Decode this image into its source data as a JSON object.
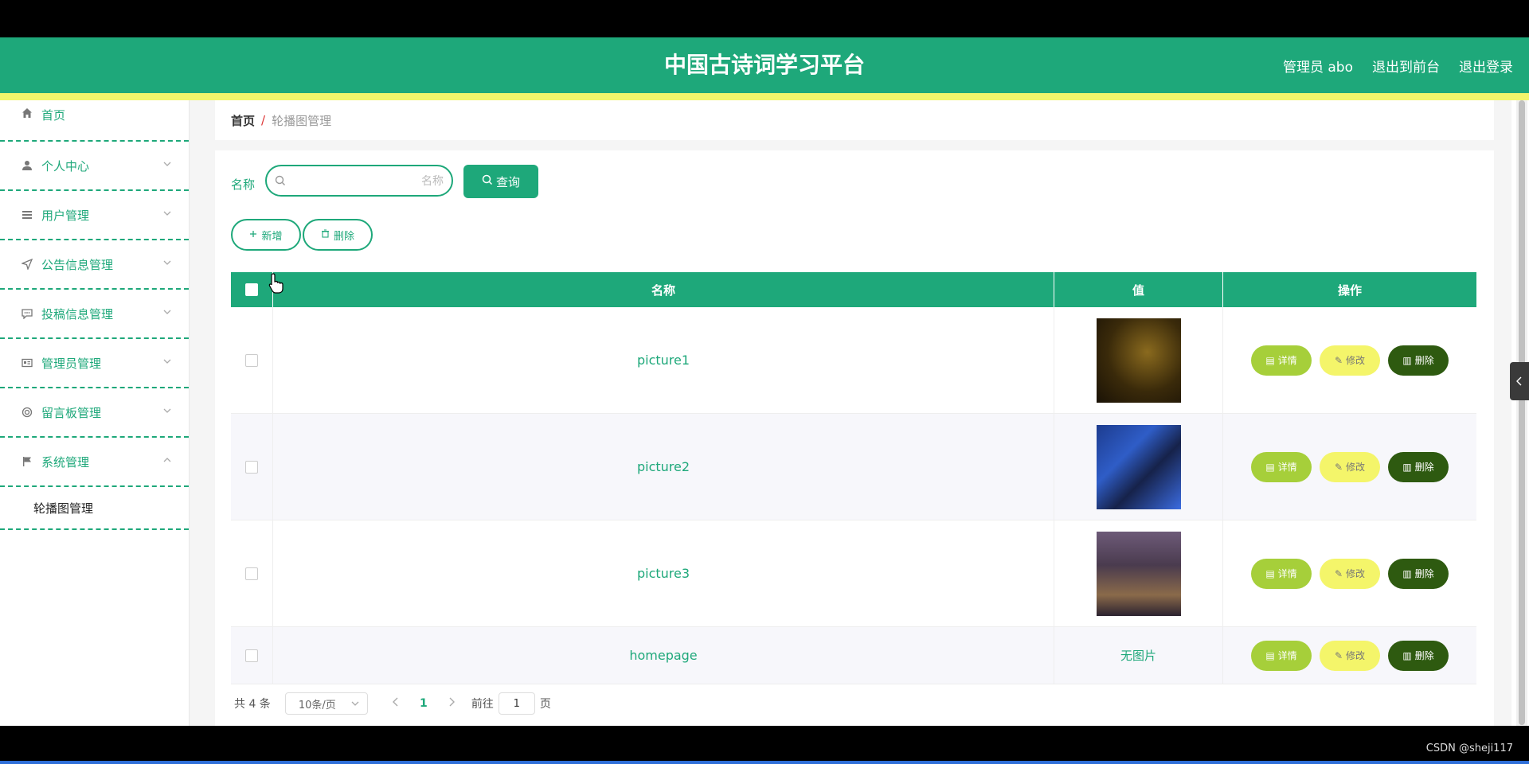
{
  "header": {
    "title": "中国古诗词学习平台",
    "user_label": "管理员 abo",
    "exit_front": "退出到前台",
    "logout": "退出登录"
  },
  "sidebar": {
    "items": [
      {
        "label": "首页",
        "icon": "home-icon"
      },
      {
        "label": "个人中心",
        "icon": "user-icon"
      },
      {
        "label": "用户管理",
        "icon": "list-icon"
      },
      {
        "label": "公告信息管理",
        "icon": "send-icon"
      },
      {
        "label": "投稿信息管理",
        "icon": "chat-icon"
      },
      {
        "label": "管理员管理",
        "icon": "id-card-icon"
      },
      {
        "label": "留言板管理",
        "icon": "lifebuoy-icon"
      },
      {
        "label": "系统管理",
        "icon": "flag-icon"
      }
    ],
    "sub_items": [
      {
        "label": "轮播图管理"
      }
    ]
  },
  "breadcrumb": {
    "home": "首页",
    "separator": "/",
    "current": "轮播图管理"
  },
  "search": {
    "label": "名称",
    "placeholder": "名称",
    "value": "",
    "query_label": "查询"
  },
  "actions": {
    "add_label": "新增",
    "delete_label": "删除"
  },
  "table": {
    "headers": {
      "name": "名称",
      "value": "值",
      "ops": "操作"
    },
    "rows": [
      {
        "name": "picture1",
        "value": "image"
      },
      {
        "name": "picture2",
        "value": "image"
      },
      {
        "name": "picture3",
        "value": "image"
      },
      {
        "name": "homepage",
        "value": "无图片"
      }
    ],
    "row_actions": {
      "detail": "详情",
      "edit": "修改",
      "delete": "删除"
    }
  },
  "pagination": {
    "total": "共 4 条",
    "page_size": "10条/页",
    "current_page": "1",
    "goto_label": "前往",
    "goto_value": "1",
    "page_suffix": "页"
  },
  "watermark": "CSDN @sheji117",
  "colors": {
    "primary": "#1ea87a",
    "stripe": "#f2f56b",
    "detail": "#a6cf3a",
    "edit": "#f4f56a",
    "delete": "#2e5a10"
  }
}
